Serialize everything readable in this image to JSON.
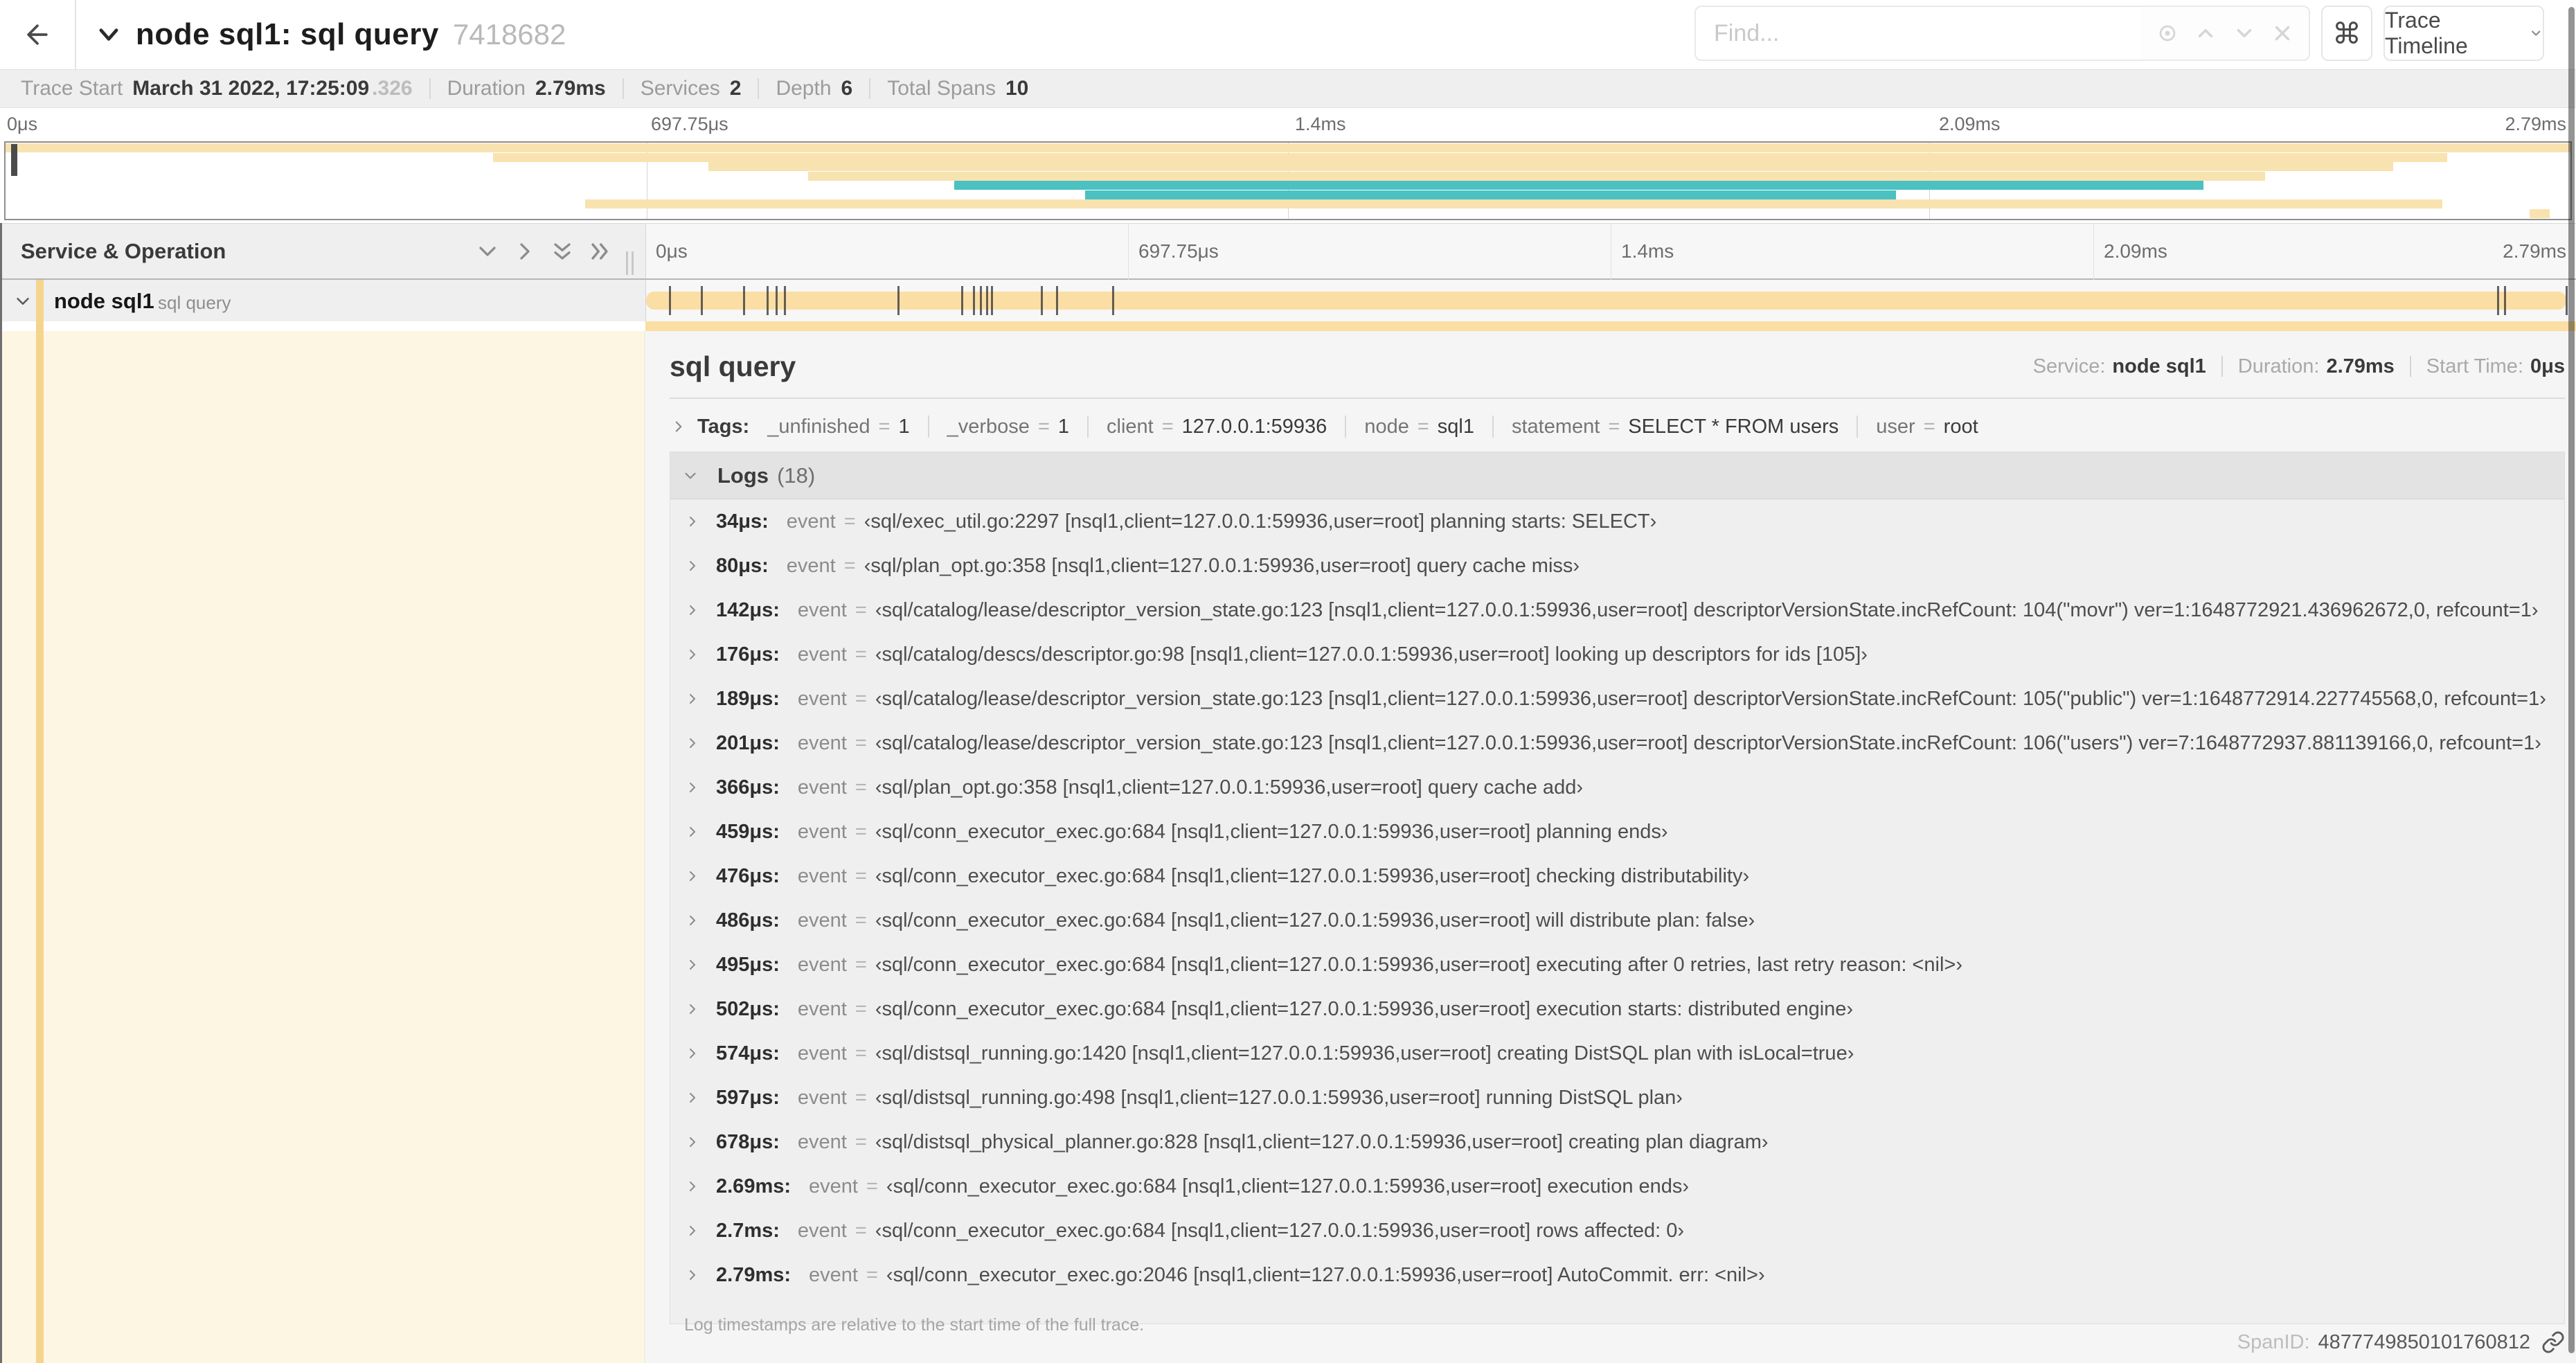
{
  "header": {
    "title": "node sql1: sql query",
    "trace_id_short": "7418682",
    "find_placeholder": "Find...",
    "cmd_button": "⌘",
    "view_dropdown": "Trace Timeline",
    "icons": [
      "back-arrow",
      "chevron-down",
      "locate-target",
      "chevron-up",
      "chevron-down",
      "close-x",
      "keyboard-shortcuts",
      "dropdown-chevron"
    ]
  },
  "trace_info": {
    "trace_start_label": "Trace Start",
    "trace_start_value": "March 31 2022, 17:25:09",
    "trace_start_fraction": ".326",
    "duration_label": "Duration",
    "duration_value": "2.79ms",
    "services_label": "Services",
    "services_value": "2",
    "depth_label": "Depth",
    "depth_value": "6",
    "total_spans_label": "Total Spans",
    "total_spans_value": "10"
  },
  "timeline": {
    "ticks": [
      "0μs",
      "697.75μs",
      "1.4ms",
      "2.09ms",
      "2.79ms"
    ],
    "total_duration_us": 2790
  },
  "minimap": {
    "rows": [
      {
        "start_pct": 0,
        "end_pct": 100,
        "color": "tan"
      },
      {
        "start_pct": 19,
        "end_pct": 95.2,
        "color": "tan"
      },
      {
        "start_pct": 27.4,
        "end_pct": 93.1,
        "color": "tan"
      },
      {
        "start_pct": 31.3,
        "end_pct": 88.1,
        "color": "tan"
      },
      {
        "start_pct": 37,
        "end_pct": 85.7,
        "color": "teal"
      },
      {
        "start_pct": 42.1,
        "end_pct": 73.7,
        "color": "teal"
      },
      {
        "start_pct": 22.6,
        "end_pct": 95,
        "color": "tan"
      },
      {
        "start_pct": 98.4,
        "end_pct": 99.2,
        "color": "tan"
      }
    ]
  },
  "span_table": {
    "header_label": "Service & Operation",
    "row": {
      "service": "node sql1",
      "operation": "sql query"
    }
  },
  "detail": {
    "operation": "sql query",
    "service_label": "Service:",
    "service": "node sql1",
    "duration_label": "Duration:",
    "duration": "2.79ms",
    "start_label": "Start Time:",
    "start": "0μs",
    "tags_label": "Tags:",
    "tags": [
      {
        "key": "_unfinished",
        "value": "1"
      },
      {
        "key": "_verbose",
        "value": "1"
      },
      {
        "key": "client",
        "value": "127.0.0.1:59936"
      },
      {
        "key": "node",
        "value": "sql1"
      },
      {
        "key": "statement",
        "value": "SELECT * FROM users"
      },
      {
        "key": "user",
        "value": "root"
      }
    ],
    "logs_label": "Logs",
    "logs_count": "(18)",
    "logs": [
      {
        "time": "34μs:",
        "time_us": 34,
        "key": "event",
        "value": "‹sql/exec_util.go:2297 [nsql1,client=127.0.0.1:59936,user=root] planning starts: SELECT›"
      },
      {
        "time": "80μs:",
        "time_us": 80,
        "key": "event",
        "value": "‹sql/plan_opt.go:358 [nsql1,client=127.0.0.1:59936,user=root] query cache miss›"
      },
      {
        "time": "142μs:",
        "time_us": 142,
        "key": "event",
        "value": "‹sql/catalog/lease/descriptor_version_state.go:123 [nsql1,client=127.0.0.1:59936,user=root] descriptorVersionState.incRefCount: 104(\"movr\") ver=1:1648772921.436962672,0, refcount=1›"
      },
      {
        "time": "176μs:",
        "time_us": 176,
        "key": "event",
        "value": "‹sql/catalog/descs/descriptor.go:98 [nsql1,client=127.0.0.1:59936,user=root] looking up descriptors for ids [105]›"
      },
      {
        "time": "189μs:",
        "time_us": 189,
        "key": "event",
        "value": "‹sql/catalog/lease/descriptor_version_state.go:123 [nsql1,client=127.0.0.1:59936,user=root] descriptorVersionState.incRefCount: 105(\"public\") ver=1:1648772914.227745568,0, refcount=1›"
      },
      {
        "time": "201μs:",
        "time_us": 201,
        "key": "event",
        "value": "‹sql/catalog/lease/descriptor_version_state.go:123 [nsql1,client=127.0.0.1:59936,user=root] descriptorVersionState.incRefCount: 106(\"users\") ver=7:1648772937.881139166,0, refcount=1›"
      },
      {
        "time": "366μs:",
        "time_us": 366,
        "key": "event",
        "value": "‹sql/plan_opt.go:358 [nsql1,client=127.0.0.1:59936,user=root] query cache add›"
      },
      {
        "time": "459μs:",
        "time_us": 459,
        "key": "event",
        "value": "‹sql/conn_executor_exec.go:684 [nsql1,client=127.0.0.1:59936,user=root] planning ends›"
      },
      {
        "time": "476μs:",
        "time_us": 476,
        "key": "event",
        "value": "‹sql/conn_executor_exec.go:684 [nsql1,client=127.0.0.1:59936,user=root] checking distributability›"
      },
      {
        "time": "486μs:",
        "time_us": 486,
        "key": "event",
        "value": "‹sql/conn_executor_exec.go:684 [nsql1,client=127.0.0.1:59936,user=root] will distribute plan: false›"
      },
      {
        "time": "495μs:",
        "time_us": 495,
        "key": "event",
        "value": "‹sql/conn_executor_exec.go:684 [nsql1,client=127.0.0.1:59936,user=root] executing after 0 retries, last retry reason: <nil>›"
      },
      {
        "time": "502μs:",
        "time_us": 502,
        "key": "event",
        "value": "‹sql/conn_executor_exec.go:684 [nsql1,client=127.0.0.1:59936,user=root] execution starts: distributed engine›"
      },
      {
        "time": "574μs:",
        "time_us": 574,
        "key": "event",
        "value": "‹sql/distsql_running.go:1420 [nsql1,client=127.0.0.1:59936,user=root] creating DistSQL plan with isLocal=true›"
      },
      {
        "time": "597μs:",
        "time_us": 597,
        "key": "event",
        "value": "‹sql/distsql_running.go:498 [nsql1,client=127.0.0.1:59936,user=root] running DistSQL plan›"
      },
      {
        "time": "678μs:",
        "time_us": 678,
        "key": "event",
        "value": "‹sql/distsql_physical_planner.go:828 [nsql1,client=127.0.0.1:59936,user=root] creating plan diagram›"
      },
      {
        "time": "2.69ms:",
        "time_us": 2690,
        "key": "event",
        "value": "‹sql/conn_executor_exec.go:684 [nsql1,client=127.0.0.1:59936,user=root] execution ends›"
      },
      {
        "time": "2.7ms:",
        "time_us": 2700,
        "key": "event",
        "value": "‹sql/conn_executor_exec.go:684 [nsql1,client=127.0.0.1:59936,user=root] rows affected: 0›"
      },
      {
        "time": "2.79ms:",
        "time_us": 2790,
        "key": "event",
        "value": "‹sql/conn_executor_exec.go:2046 [nsql1,client=127.0.0.1:59936,user=root] AutoCommit. err: <nil>›"
      }
    ],
    "note": "Log timestamps are relative to the start time of the full trace.",
    "span_id_label": "SpanID:",
    "span_id": "4877749850101760812"
  },
  "colors": {
    "tan": "#fadea3",
    "tan_light": "#f8e2b0",
    "teal": "#4bc1c1",
    "accent_stripe": "#f5d58e",
    "selected_row_bg": "#fcf6e3"
  }
}
